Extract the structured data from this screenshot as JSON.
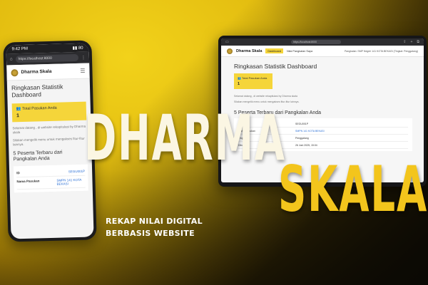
{
  "colors": {
    "accent_yellow": "#f5d53a",
    "title_light": "#fbf6e3",
    "title_yellow": "#f3c51c",
    "link_blue": "#2a6fd6"
  },
  "hero": {
    "title": "Dharma",
    "subtitle": "Skala",
    "tagline_line1": "REKAP NILAI DIGITAL",
    "tagline_line2": "BERBASIS WEBSITE"
  },
  "phone": {
    "status_time": "9:42 PM",
    "status_right": "▮▮ 80",
    "url": "https://localhost:8000",
    "brand": "Dharma Skala",
    "menu_icon": "hamburger-icon",
    "page_title": "Ringkasan Statistik Dashboard",
    "card": {
      "label": "Total Pasukan Anda",
      "value": "1"
    },
    "welcome_text": "Selamat datang , di website rekapitulasi by Dharma skala",
    "hint_text": "Silakan mengelik menu untuk mengakses fitur-fitur lainnya.",
    "section_title": "5 Peserta Terbaru dari Pangkalan Anda",
    "table": [
      {
        "key": "ID",
        "value": "SEGU001P"
      },
      {
        "key": "Nama Pasukan",
        "value": "SMPN 141 KOTA BEKASI"
      }
    ]
  },
  "laptop": {
    "url": "https://localhost:8000",
    "brand": "Dharma Skala",
    "nav_active": "Dashboard",
    "nav_link": "Nilai Pangkalan Saya",
    "user_text": "Pangkalan: SMP Negeri 141 KOTA BEKASI (Tingkat: Penggalang)",
    "page_title": "Ringkasan Statistik Dashboard",
    "card": {
      "label": "Total Pasukan Anda",
      "value": "1"
    },
    "welcome_text": "Selamat datang , di website rekapitulasi by Dharma skala",
    "hint_text": "Silakan mengelik menu untuk mengakses fitur-fitur lainnya.",
    "section_title": "5 Peserta Terbaru dari Pangkalan Anda",
    "table": [
      {
        "key": "ID",
        "value": "SEGU001P"
      },
      {
        "key": "Nama Pasukan",
        "value": "SMPN 141 KOTA BEKASI"
      },
      {
        "key": "Tingkat",
        "value": "Penggalang"
      },
      {
        "key": "Dibuat",
        "value": "26 Juni 2025, 15:04"
      }
    ]
  }
}
